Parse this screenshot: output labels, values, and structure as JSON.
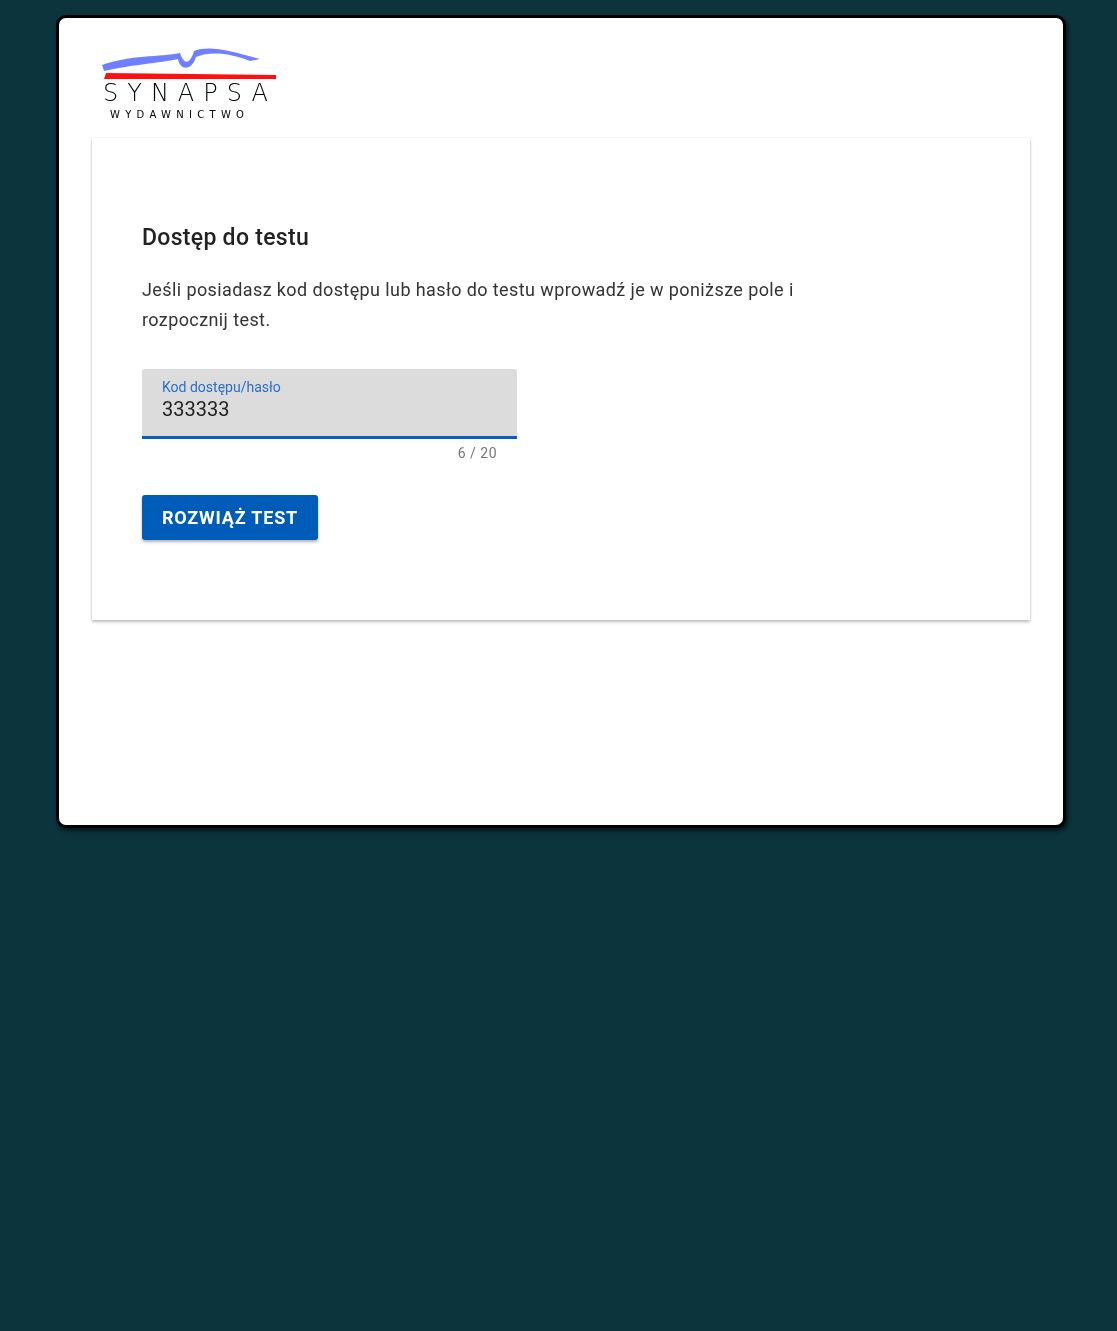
{
  "logo": {
    "name": "SYNAPSA",
    "subtitle": "WYDAWNICTWO"
  },
  "card": {
    "title": "Dostęp do testu",
    "description": "Jeśli posiadasz kod dostępu lub hasło do testu wprowadź je w poniższe pole i rozpocznij test.",
    "field": {
      "label": "Kod dostępu/hasło",
      "value": "333333",
      "counter": "6 / 20",
      "focused": true
    },
    "button": "ROZWIĄŻ TEST"
  }
}
